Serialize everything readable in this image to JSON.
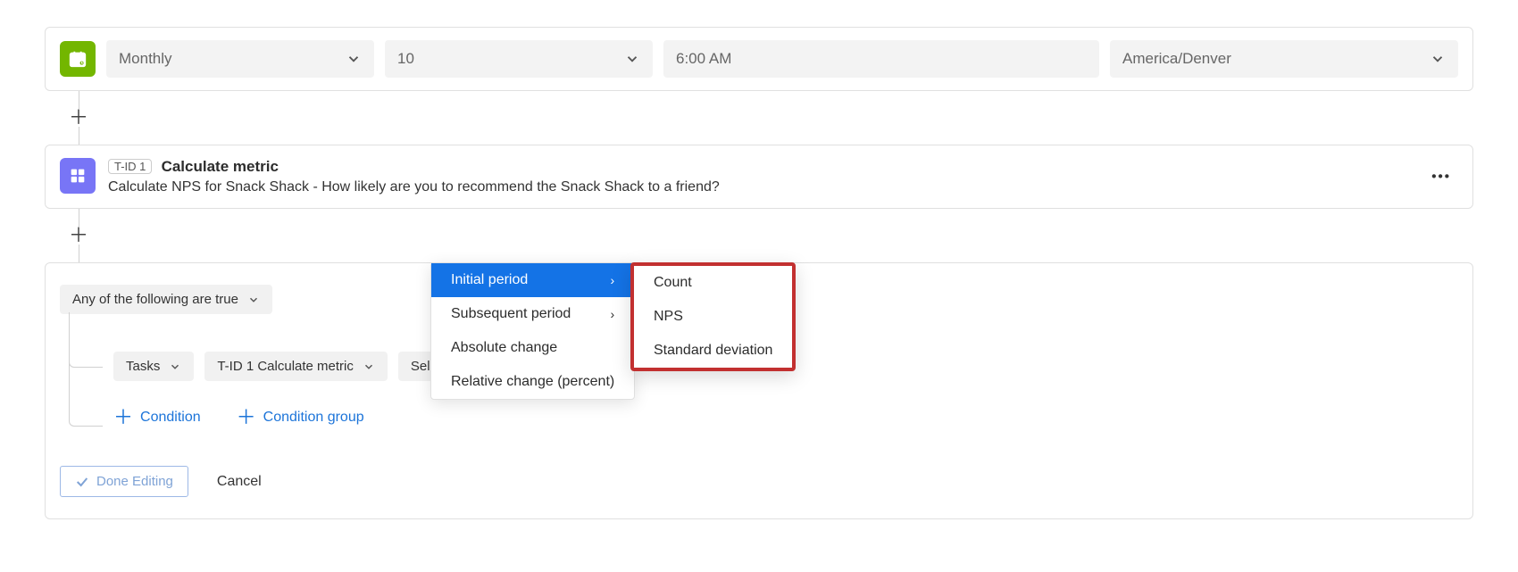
{
  "schedule": {
    "frequency": "Monthly",
    "day": "10",
    "time": "6:00 AM",
    "timezone": "America/Denver"
  },
  "metric_task": {
    "tid": "T-ID 1",
    "title": "Calculate metric",
    "description": "Calculate NPS for Snack Shack - How likely are you to recommend the Snack Shack to a friend?"
  },
  "conditions": {
    "group_label": "Any of the following are true",
    "row": {
      "source": "Tasks",
      "task": "T-ID 1 Calculate metric",
      "option": "Select Option"
    },
    "add_condition": "Condition",
    "add_group": "Condition group"
  },
  "menu": {
    "primary": [
      "Initial period",
      "Subsequent period",
      "Absolute change",
      "Relative change (percent)"
    ],
    "sub": [
      "Count",
      "NPS",
      "Standard deviation"
    ]
  },
  "footer": {
    "done": "Done Editing",
    "cancel": "Cancel"
  }
}
